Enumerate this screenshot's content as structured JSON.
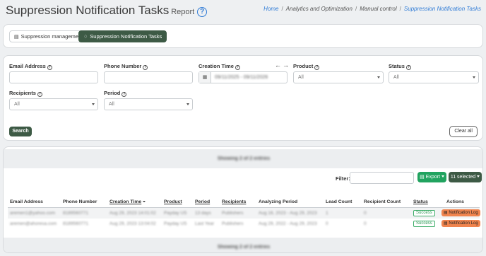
{
  "header": {
    "title": "Suppression Notification Tasks",
    "subtitle": "Report",
    "help_icon": "?",
    "breadcrumb": [
      "Home",
      "Analytics and Optimization",
      "Manual control",
      "Suppression Notification Tasks"
    ]
  },
  "tabs": [
    {
      "label": "Suppression management",
      "icon": "list-icon"
    },
    {
      "label": "Suppression Notification Tasks",
      "icon": "bell-icon"
    }
  ],
  "filters": {
    "email_label": "Email Address",
    "email_value": "",
    "phone_label": "Phone Number",
    "phone_value": "",
    "creation_label": "Creation Time",
    "creation_value": "09/11/2025 - 09/11/2026",
    "product_label": "Product",
    "product_value": "All",
    "status_label": "Status",
    "status_value": "All",
    "recipients_label": "Recipients",
    "recipients_value": "All",
    "period_label": "Period",
    "period_value": "All",
    "search_label": "Search",
    "clear_label": "Clear all"
  },
  "results": {
    "info_top": "Showing 2 of 2 entries",
    "info_bottom": "Showing 2 of 2 entries",
    "filter_label": "Filter:",
    "filter_value": "",
    "export_label": "Export",
    "selected_label": "11 selected",
    "columns": {
      "email": "Email Address",
      "phone": "Phone Number",
      "creation": "Creation Time",
      "product": "Product",
      "period": "Period",
      "recipients": "Recipients",
      "analyzing": "Analyzing Period",
      "lead_count": "Lead Count",
      "recipient_count": "Recipient Count",
      "status": "Status",
      "actions": "Actions"
    },
    "rows": [
      {
        "email": "aremen1@yahoo.com",
        "phone": "8189560771",
        "creation": "Aug 29, 2023 14:01:02",
        "product": "Payday US",
        "period": "13 days",
        "recipients": "Publishers",
        "analyzing": "Aug 16, 2023 - Aug 29, 2023",
        "lead_count": "1",
        "recipient_count": "0",
        "status": "Success",
        "action": "Notification Log"
      },
      {
        "email": "aremen@ahoresa.com",
        "phone": "8189560771",
        "creation": "Aug 29, 2023 13:04:02",
        "product": "Payday US",
        "period": "Last Year",
        "recipients": "Publishers",
        "analyzing": "Aug 29, 2022 - Aug 29, 2023",
        "lead_count": "0",
        "recipient_count": "0",
        "status": "Success",
        "action": "Notification Log"
      }
    ]
  },
  "colors": {
    "primary": "#3d5a45",
    "export": "#21a35f",
    "action": "#f0844e",
    "success": "#2e9a57",
    "link": "#2f7bd6"
  }
}
